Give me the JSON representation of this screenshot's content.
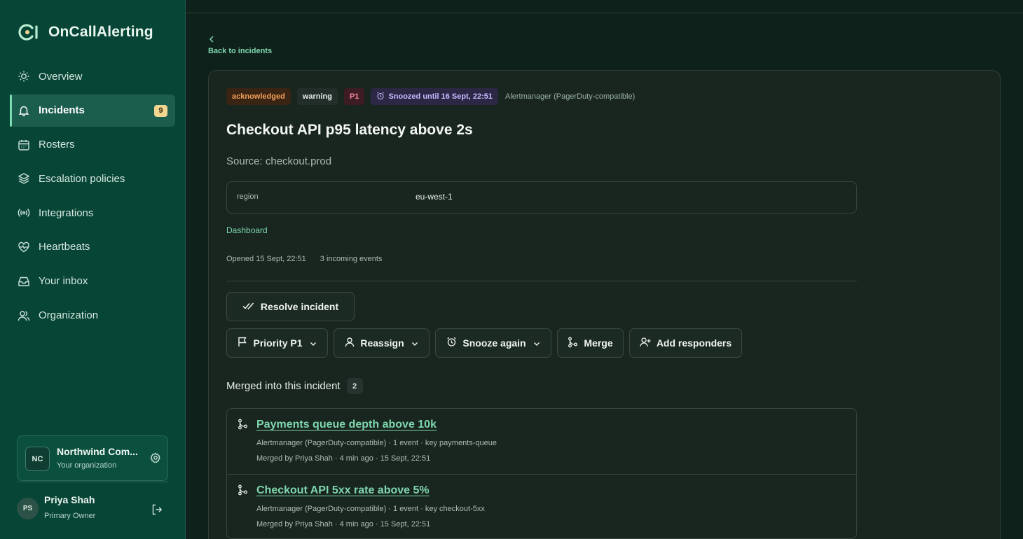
{
  "app": {
    "name": "OnCallAlerting"
  },
  "colors": {
    "sidebar": "#074536",
    "accent": "#7fd6ae",
    "background": "#0f211b",
    "badge": "#f3d592"
  },
  "sidebar": {
    "items": [
      {
        "label": "Overview",
        "icon": "sun-icon"
      },
      {
        "label": "Incidents",
        "icon": "bell-icon",
        "badge": "9",
        "active": true
      },
      {
        "label": "Rosters",
        "icon": "calendar-icon"
      },
      {
        "label": "Escalation policies",
        "icon": "layers-icon"
      },
      {
        "label": "Integrations",
        "icon": "broadcast-icon"
      },
      {
        "label": "Heartbeats",
        "icon": "heart-pulse-icon"
      },
      {
        "label": "Your inbox",
        "icon": "inbox-icon"
      },
      {
        "label": "Organization",
        "icon": "users-icon"
      }
    ],
    "org": {
      "initials": "NC",
      "name": "Northwind Com...",
      "subtitle": "Your organization"
    },
    "user": {
      "initials": "PS",
      "name": "Priya Shah",
      "role": "Primary Owner"
    }
  },
  "incident": {
    "back_label": "Back to incidents",
    "status": "acknowledged",
    "severity": "warning",
    "priority": "P1",
    "snooze": "Snoozed until 16 Sept, 22:51",
    "integration": "Alertmanager (PagerDuty-compatible)",
    "title": "Checkout API p95 latency above 2s",
    "source": "Source: checkout.prod",
    "labels": [
      {
        "key": "region",
        "value": "eu-west-1"
      }
    ],
    "dashboard_link": "Dashboard",
    "opened": "Opened 15 Sept, 22:51",
    "events": "3 incoming events"
  },
  "actions": {
    "resolve": "Resolve incident",
    "priority": "Priority P1",
    "reassign": "Reassign",
    "snooze": "Snooze again",
    "merge": "Merge",
    "add_responders": "Add responders"
  },
  "merged": {
    "heading": "Merged into this incident",
    "count": "2",
    "items": [
      {
        "title": "Payments queue depth above 10k",
        "details": "Alertmanager (PagerDuty-compatible) · 1 event · key payments-queue",
        "merged_by": "Merged by Priya Shah · 4 min ago · 15 Sept, 22:51"
      },
      {
        "title": "Checkout API 5xx rate above 5%",
        "details": "Alertmanager (PagerDuty-compatible) · 1 event · key checkout-5xx",
        "merged_by": "Merged by Priya Shah · 4 min ago · 15 Sept, 22:51"
      }
    ]
  }
}
